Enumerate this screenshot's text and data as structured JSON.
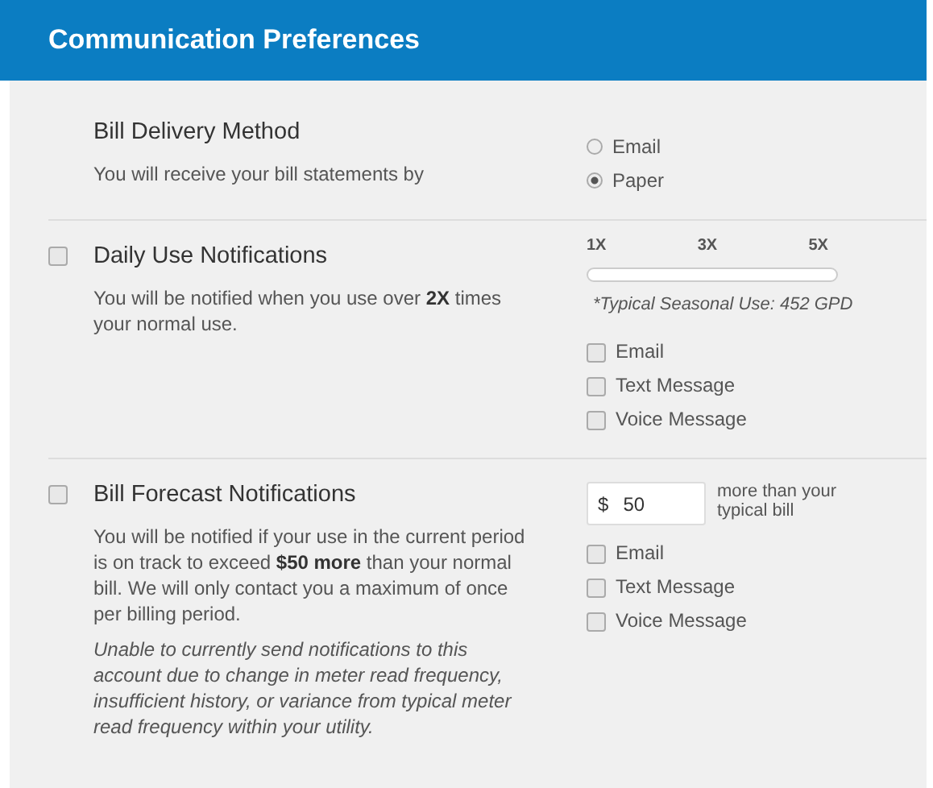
{
  "header": {
    "title": "Communication Preferences"
  },
  "sections": [
    {
      "kind": "radio",
      "title": "Bill Delivery Method",
      "description": "You will receive your bill statements by",
      "options": [
        {
          "label": "Email",
          "selected": false
        },
        {
          "label": "Paper",
          "selected": true
        }
      ]
    },
    {
      "kind": "slider",
      "checked": false,
      "title": "Daily Use Notifications",
      "description": "You will be notified when you use over **2X** times your normal use.",
      "scale": [
        "1X",
        "3X",
        "5X"
      ],
      "note": "*Typical Seasonal Use: 452 GPD",
      "channels": [
        {
          "label": "Email",
          "checked": false
        },
        {
          "label": "Text Message",
          "checked": false
        },
        {
          "label": "Voice Message",
          "checked": false
        }
      ]
    },
    {
      "kind": "amount",
      "checked": false,
      "title": "Bill Forecast Notifications",
      "description": "You will be notified if your use in the current period is on track to exceed **$50 more** than your normal bill. We will only contact you a maximum of once per billing period.",
      "note": "Unable to currently send notifications to this account due to change in meter read frequency, insufficient history, or variance from typical meter read frequency within your utility.",
      "currency": "$",
      "amount": "50",
      "amount_suffix": "more than your typical bill",
      "channels": [
        {
          "label": "Email",
          "checked": false
        },
        {
          "label": "Text Message",
          "checked": false
        },
        {
          "label": "Voice Message",
          "checked": false
        }
      ]
    }
  ]
}
